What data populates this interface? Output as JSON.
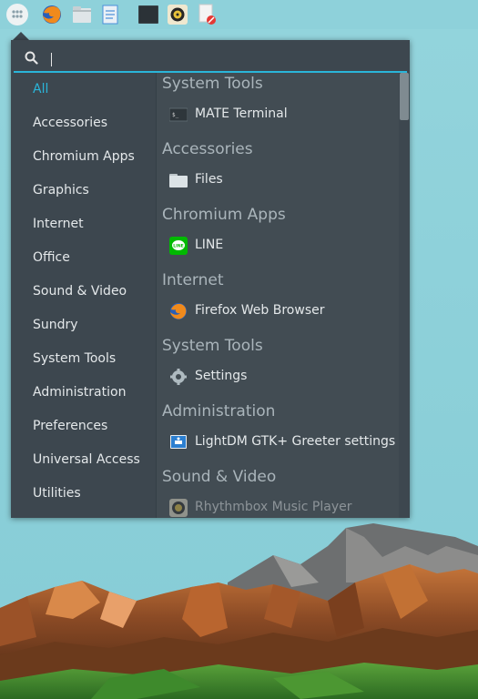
{
  "panel": {
    "launchers": [
      {
        "name": "app-menu-icon"
      },
      {
        "name": "firefox-icon"
      },
      {
        "name": "files-icon"
      },
      {
        "name": "text-editor-icon"
      },
      {
        "name": "terminal-icon"
      },
      {
        "name": "rhythmbox-icon"
      },
      {
        "name": "screenshot-icon"
      }
    ]
  },
  "menu": {
    "search": {
      "value": "",
      "placeholder": ""
    },
    "categories": [
      {
        "label": "All",
        "active": true
      },
      {
        "label": "Accessories"
      },
      {
        "label": "Chromium Apps"
      },
      {
        "label": "Graphics"
      },
      {
        "label": "Internet"
      },
      {
        "label": "Office"
      },
      {
        "label": "Sound & Video"
      },
      {
        "label": "Sundry"
      },
      {
        "label": "System Tools"
      },
      {
        "label": "Administration"
      },
      {
        "label": "Preferences"
      },
      {
        "label": "Universal Access"
      },
      {
        "label": "Utilities"
      }
    ],
    "sections": [
      {
        "header": "System Tools",
        "apps": [
          {
            "label": "MATE Terminal",
            "icon": "terminal-icon"
          }
        ]
      },
      {
        "header": "Accessories",
        "apps": [
          {
            "label": "Files",
            "icon": "folder-icon"
          }
        ]
      },
      {
        "header": "Chromium Apps",
        "apps": [
          {
            "label": "LINE",
            "icon": "line-icon"
          }
        ]
      },
      {
        "header": "Internet",
        "apps": [
          {
            "label": "Firefox Web Browser",
            "icon": "firefox-icon"
          }
        ]
      },
      {
        "header": "System Tools",
        "apps": [
          {
            "label": "Settings",
            "icon": "gear-icon"
          }
        ]
      },
      {
        "header": "Administration",
        "apps": [
          {
            "label": "LightDM GTK+ Greeter settings",
            "icon": "lightdm-icon"
          }
        ]
      },
      {
        "header": "Sound & Video",
        "apps": [
          {
            "label": "Rhythmbox Music Player",
            "icon": "rhythmbox-icon"
          }
        ]
      }
    ],
    "colors": {
      "accent": "#2ab5d9",
      "menu_bg": "#3d474f",
      "list_bg": "#424c53"
    }
  }
}
